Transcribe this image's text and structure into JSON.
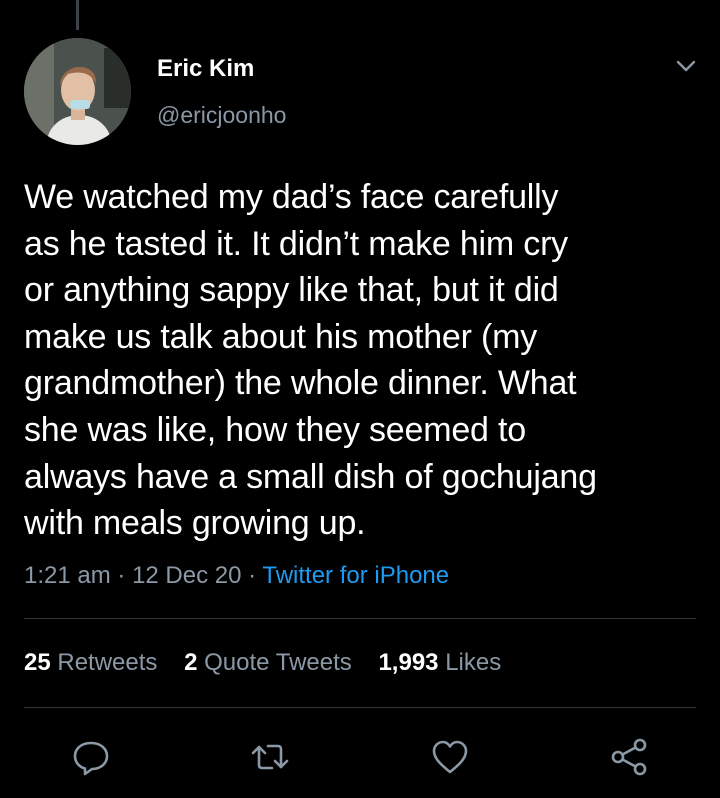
{
  "author": {
    "name": "Eric Kim",
    "handle": "@ericjoonho",
    "avatar": "profile-photo"
  },
  "tweet": {
    "text": "We watched my dad’s face carefully\nas he tasted it. It didn’t make him cry\nor anything sappy like that, but it did\nmake us talk about his mother (my\ngrandmother) the whole dinner. What\nshe was like, how they seemed to\nalways have a small dish of gochujang\nwith meals growing up.",
    "time": "1:21 am",
    "date": "12 Dec 20",
    "separator": "·",
    "source": "Twitter for iPhone"
  },
  "stats": {
    "retweets_count": "25",
    "retweets_label": "Retweets",
    "quote_count": "2",
    "quote_label": "Quote Tweets",
    "likes_count": "1,993",
    "likes_label": "Likes"
  },
  "actions": {
    "reply_icon": "reply-icon",
    "retweet_icon": "retweet-icon",
    "like_icon": "heart-icon",
    "share_icon": "share-icon",
    "menu_icon": "chevron-down-icon"
  },
  "colors": {
    "background": "#000000",
    "text": "#ffffff",
    "secondary": "#8b98a5",
    "link": "#1d9bf0",
    "divider": "#2f3336"
  }
}
